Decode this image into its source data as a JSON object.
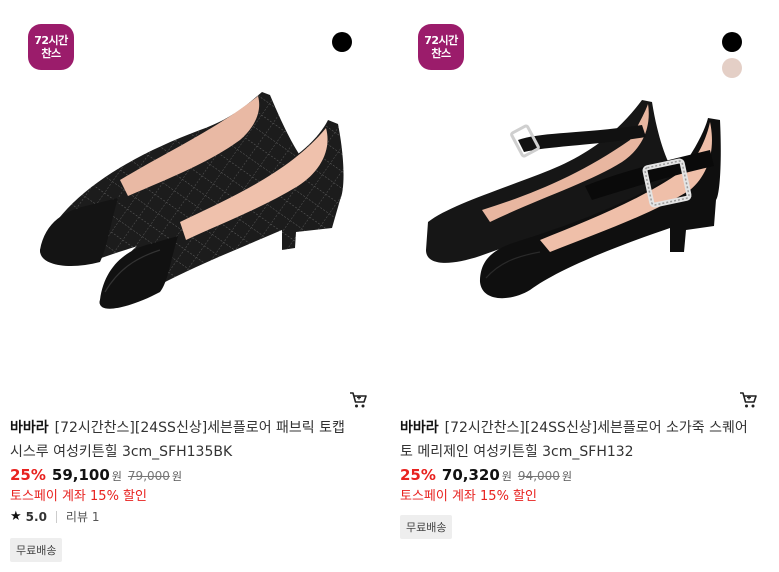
{
  "products": [
    {
      "badge_line1": "72시간",
      "badge_line2": "찬스",
      "swatch_colors": [
        "#000000"
      ],
      "brand": "바바라",
      "name": "[72시간찬스][24SS신상]세븐플로어 패브릭 토캡 시스루 여성키튼힐 3cm_SFH135BK",
      "discount": "25%",
      "price": "59,100",
      "currency": "원",
      "original_price": "79,000",
      "original_currency": "원",
      "promo": "토스페이 계좌 15% 할인",
      "rating_star": "★",
      "rating": "5.0",
      "review_label": "리뷰 1",
      "shipping": "무료배송",
      "image": "black-tweed-pointed-toe-flat",
      "cart_icon": "cart-icon"
    },
    {
      "badge_line1": "72시간",
      "badge_line2": "찬스",
      "swatch_colors": [
        "#000000",
        "#e4cfc6"
      ],
      "brand": "바바라",
      "name": "[72시간찬스][24SS신상]세븐플로어 소가죽 스퀘어토 메리제인 여성키튼힐 3cm_SFH132",
      "discount": "25%",
      "price": "70,320",
      "currency": "원",
      "original_price": "94,000",
      "original_currency": "원",
      "promo": "토스페이 계좌 15% 할인",
      "shipping": "무료배송",
      "image": "black-leather-mary-jane-buckle",
      "cart_icon": "cart-icon"
    }
  ],
  "colors": {
    "badge": "#9b1c6b",
    "discount": "#e8221f",
    "promo": "#e8221f"
  }
}
